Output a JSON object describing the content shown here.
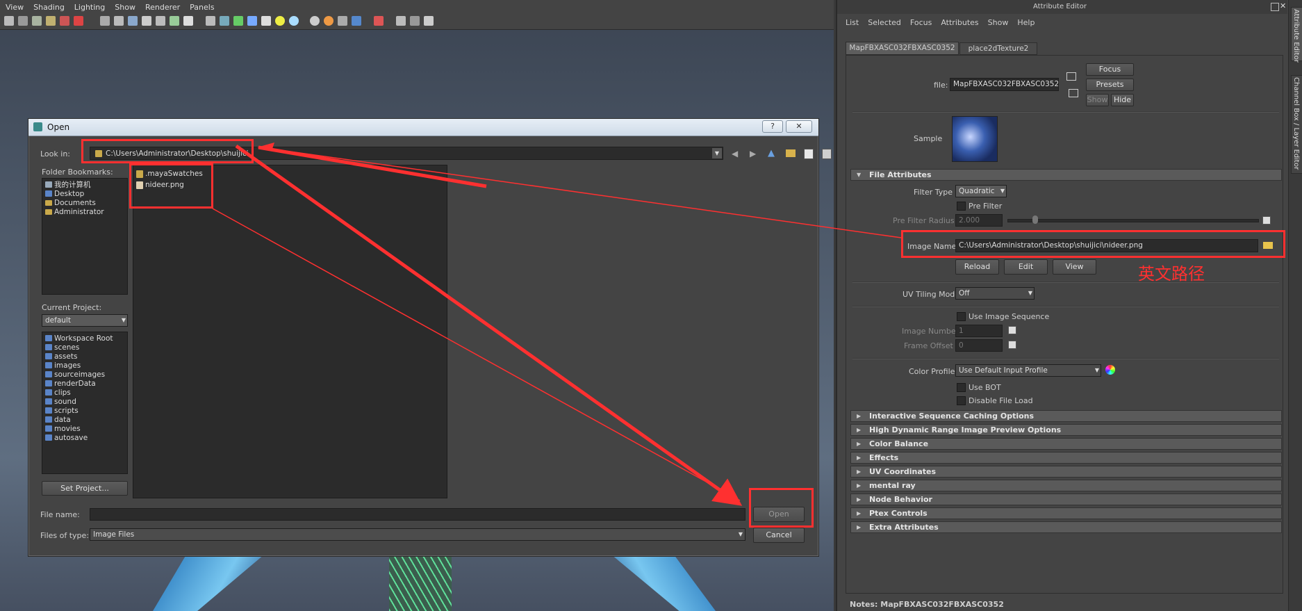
{
  "menubar": {
    "items": [
      "View",
      "Shading",
      "Lighting",
      "Show",
      "Renderer",
      "Panels"
    ]
  },
  "dialog": {
    "title": "Open",
    "help_label": "?",
    "close_label": "✕",
    "look_in_label": "Look in:",
    "look_in_path": "C:\\Users\\Administrator\\Desktop\\shuijici",
    "files": [
      ".mayaSwatches",
      "nideer.png"
    ],
    "folder_bookmarks_label": "Folder Bookmarks:",
    "bookmarks": [
      "我的计算机",
      "Desktop",
      "Documents",
      "Administrator"
    ],
    "current_project_label": "Current Project:",
    "current_project_value": "default",
    "project_folders": [
      "Workspace Root",
      "scenes",
      "assets",
      "images",
      "sourceimages",
      "renderData",
      "clips",
      "sound",
      "scripts",
      "data",
      "movies",
      "autosave"
    ],
    "set_project_label": "Set Project...",
    "file_name_label": "File name:",
    "file_name_value": "",
    "files_of_type_label": "Files of type:",
    "files_of_type_value": "Image Files",
    "open_label": "Open",
    "cancel_label": "Cancel"
  },
  "ae": {
    "window_title": "Attribute Editor",
    "menu": [
      "List",
      "Selected",
      "Focus",
      "Attributes",
      "Show",
      "Help"
    ],
    "tabs": [
      "MapFBXASC032FBXASC0352",
      "place2dTexture2"
    ],
    "file_label": "file:",
    "file_value": "MapFBXASC032FBXASC0352",
    "focus_label": "Focus",
    "presets_label": "Presets",
    "show_label": "Show",
    "hide_label": "Hide",
    "sample_label": "Sample",
    "file_attributes_label": "File Attributes",
    "filter_type_label": "Filter Type",
    "filter_type_value": "Quadratic",
    "pre_filter_label": "Pre Filter",
    "pre_filter_radius_label": "Pre Filter Radius",
    "pre_filter_radius_value": "2.000",
    "image_name_label": "Image Name",
    "image_name_value": "C:\\Users\\Administrator\\Desktop\\shuijici\\nideer.png",
    "reload_label": "Reload",
    "edit_label": "Edit",
    "view_label": "View",
    "uv_tiling_label": "UV Tiling Mode",
    "uv_tiling_value": "Off",
    "use_image_sequence_label": "Use Image Sequence",
    "image_number_label": "Image Number",
    "image_number_value": "1",
    "frame_offset_label": "Frame Offset",
    "frame_offset_value": "0",
    "color_profile_label": "Color Profile",
    "color_profile_value": "Use Default Input Profile",
    "use_bot_label": "Use BOT",
    "disable_file_load_label": "Disable File Load",
    "sections": [
      "Interactive Sequence Caching Options",
      "High Dynamic Range Image Preview Options",
      "Color Balance",
      "Effects",
      "UV Coordinates",
      "mental ray",
      "Node Behavior",
      "Ptex Controls",
      "Extra Attributes"
    ],
    "notes_label": "Notes:  MapFBXASC032FBXASC0352",
    "side_tabs": [
      "Attribute Editor",
      "Channel Box / Layer Editor"
    ]
  },
  "annotation": {
    "text": "英文路径",
    "color": "#ff3030"
  }
}
